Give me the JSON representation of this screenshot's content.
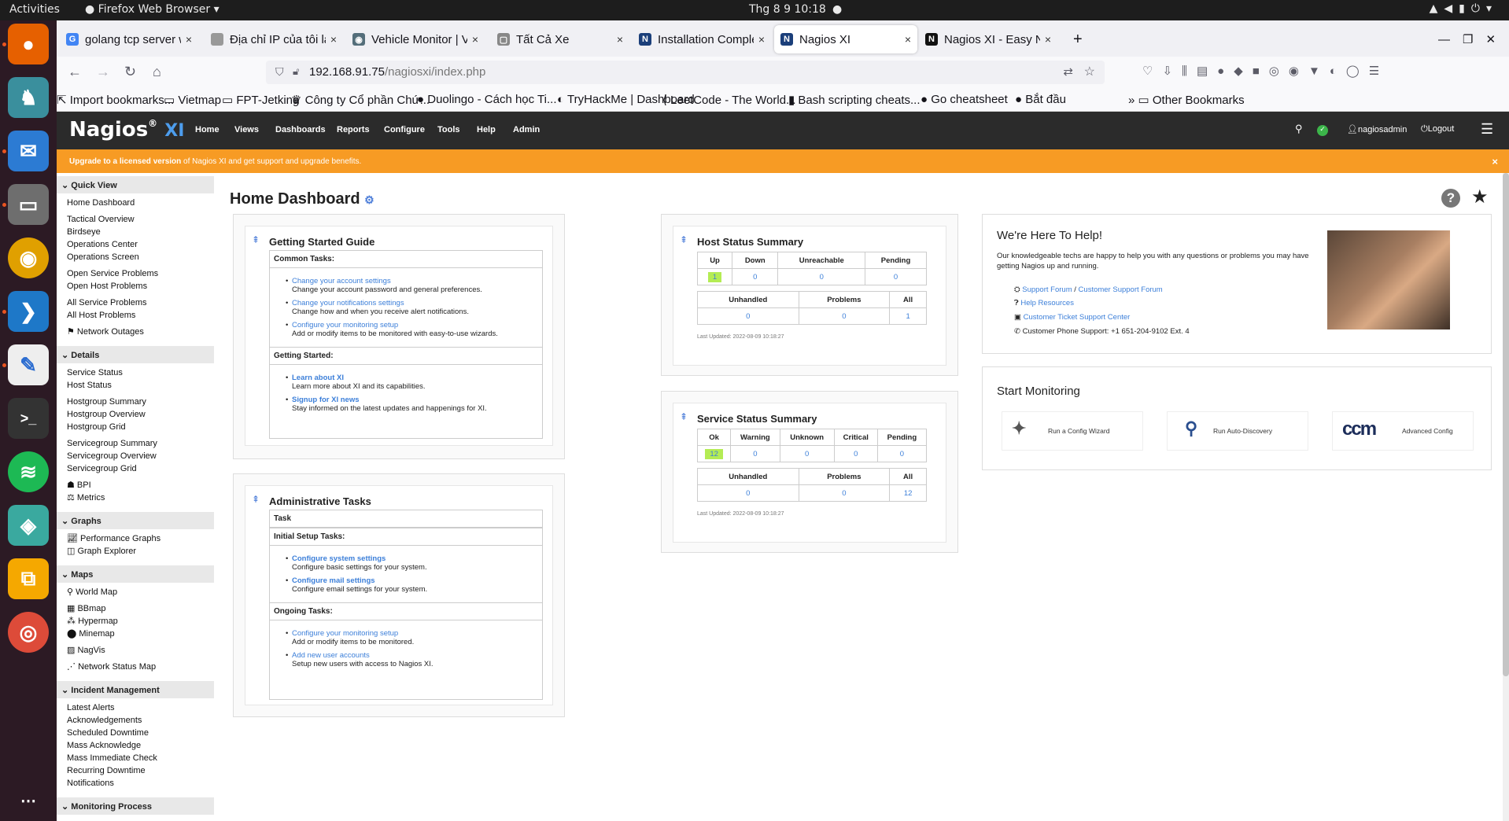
{
  "desktop": {
    "activities": "Activities",
    "app_menu": "Firefox Web Browser",
    "clock": "Thg 8 9  10:18"
  },
  "tabs": [
    {
      "title": "golang tcp server with m",
      "favicon": "G",
      "color": "#4285f4"
    },
    {
      "title": "Địa chỉ IP của tôi là gì - Xem",
      "favicon": "",
      "color": "#999"
    },
    {
      "title": "Vehicle Monitor | VIETMA",
      "favicon": "◉",
      "color": "#546e7a"
    },
    {
      "title": "Tất Cả Xe",
      "favicon": "▢",
      "color": "#888"
    },
    {
      "title": "Installation Complete · N",
      "favicon": "N",
      "color": "#1b3f7a"
    },
    {
      "title": "Nagios XI",
      "favicon": "N",
      "color": "#1b3f7a"
    },
    {
      "title": "Nagios XI - Easy Network",
      "favicon": "N",
      "color": "#111"
    }
  ],
  "url": {
    "host": "192.168.91.75",
    "path": "/nagiosxi/index.php"
  },
  "bookmarks": [
    "Import bookmarks...",
    "Vietmap",
    "FPT-Jetking",
    "Công ty Cổ phần Chứ...",
    "Duolingo - Cách học Ti...",
    "TryHackMe | Dashboard",
    "LeetCode - The World...",
    "Bash scripting cheats...",
    "Go cheatsheet",
    "Bắt đầu"
  ],
  "other_bookmarks": "Other Bookmarks",
  "nagios": {
    "logo": "Nagios",
    "logo_xi": "XI",
    "menu": [
      "Home",
      "Views",
      "Dashboards",
      "Reports",
      "Configure",
      "Tools",
      "Help",
      "Admin"
    ],
    "user": "nagiosadmin",
    "logout": "Logout",
    "banner_link": "Upgrade to a licensed version",
    "banner_rest": " of Nagios XI and get support and upgrade benefits."
  },
  "sidebar": {
    "quick_view": "Quick View",
    "quick_items": [
      "Home Dashboard",
      "Tactical Overview",
      "Birdseye",
      "Operations Center",
      "Operations Screen",
      "Open Service Problems",
      "Open Host Problems",
      "All Service Problems",
      "All Host Problems",
      "Network Outages"
    ],
    "details": "Details",
    "details_items": [
      "Service Status",
      "Host Status",
      "Hostgroup Summary",
      "Hostgroup Overview",
      "Hostgroup Grid",
      "Servicegroup Summary",
      "Servicegroup Overview",
      "Servicegroup Grid",
      "BPI",
      "Metrics"
    ],
    "graphs": "Graphs",
    "graphs_items": [
      "Performance Graphs",
      "Graph Explorer"
    ],
    "maps": "Maps",
    "maps_items": [
      "World Map",
      "BBmap",
      "Hypermap",
      "Minemap",
      "NagVis",
      "Network Status Map"
    ],
    "incident": "Incident Management",
    "incident_items": [
      "Latest Alerts",
      "Acknowledgements",
      "Scheduled Downtime",
      "Mass Acknowledge",
      "Mass Immediate Check",
      "Recurring Downtime",
      "Notifications"
    ],
    "monitoring": "Monitoring Process"
  },
  "page_title": "Home Dashboard",
  "getting_started": {
    "title": "Getting Started Guide",
    "common": "Common Tasks:",
    "common_tasks": [
      {
        "link": "Change your account settings",
        "desc": "Change your account password and general preferences."
      },
      {
        "link": "Change your notifications settings",
        "desc": "Change how and when you receive alert notifications."
      },
      {
        "link": "Configure your monitoring setup",
        "desc": "Add or modify items to be monitored with easy-to-use wizards."
      }
    ],
    "started": "Getting Started:",
    "started_tasks": [
      {
        "link": "Learn about XI",
        "desc": "Learn more about XI and its capabilities."
      },
      {
        "link": "Signup for XI news",
        "desc": "Stay informed on the latest updates and happenings for XI."
      }
    ]
  },
  "admin": {
    "title": "Administrative Tasks",
    "task_header": "Task",
    "initial": "Initial Setup Tasks:",
    "initial_tasks": [
      {
        "link": "Configure system settings",
        "desc": "Configure basic settings for your system."
      },
      {
        "link": "Configure mail settings",
        "desc": "Configure email settings for your system."
      }
    ],
    "ongoing": "Ongoing Tasks:",
    "ongoing_tasks": [
      {
        "link": "Configure your monitoring setup",
        "desc": "Add or modify items to be monitored."
      },
      {
        "link": "Add new user accounts",
        "desc": "Setup new users with access to Nagios XI."
      }
    ]
  },
  "host_status": {
    "title": "Host Status Summary",
    "h1": [
      "Up",
      "Down",
      "Unreachable",
      "Pending"
    ],
    "v1": [
      "1",
      "0",
      "0",
      "0"
    ],
    "h2": [
      "Unhandled",
      "Problems",
      "All"
    ],
    "v2": [
      "0",
      "0",
      "1"
    ],
    "updated": "Last Updated: 2022-08-09 10:18:27"
  },
  "service_status": {
    "title": "Service Status Summary",
    "h1": [
      "Ok",
      "Warning",
      "Unknown",
      "Critical",
      "Pending"
    ],
    "v1": [
      "12",
      "0",
      "0",
      "0",
      "0"
    ],
    "h2": [
      "Unhandled",
      "Problems",
      "All"
    ],
    "v2": [
      "0",
      "0",
      "12"
    ],
    "updated": "Last Updated: 2022-08-09 10:18:27"
  },
  "help": {
    "title": "We're Here To Help!",
    "text": "Our knowledgeable techs are happy to help you with any questions or problems you may have getting Nagios up and running.",
    "support_forum": "Support Forum",
    "sep": " / ",
    "customer_forum": "Customer Support Forum",
    "help_resources": "Help Resources",
    "ticket": "Customer Ticket Support Center",
    "phone": "Customer Phone Support: +1 651-204-9102 Ext. 4"
  },
  "start": {
    "title": "Start Monitoring",
    "wizard": "Run a Config Wizard",
    "discovery": "Run Auto-Discovery",
    "ccm_logo": "ccm",
    "ccm": "Advanced Config"
  }
}
